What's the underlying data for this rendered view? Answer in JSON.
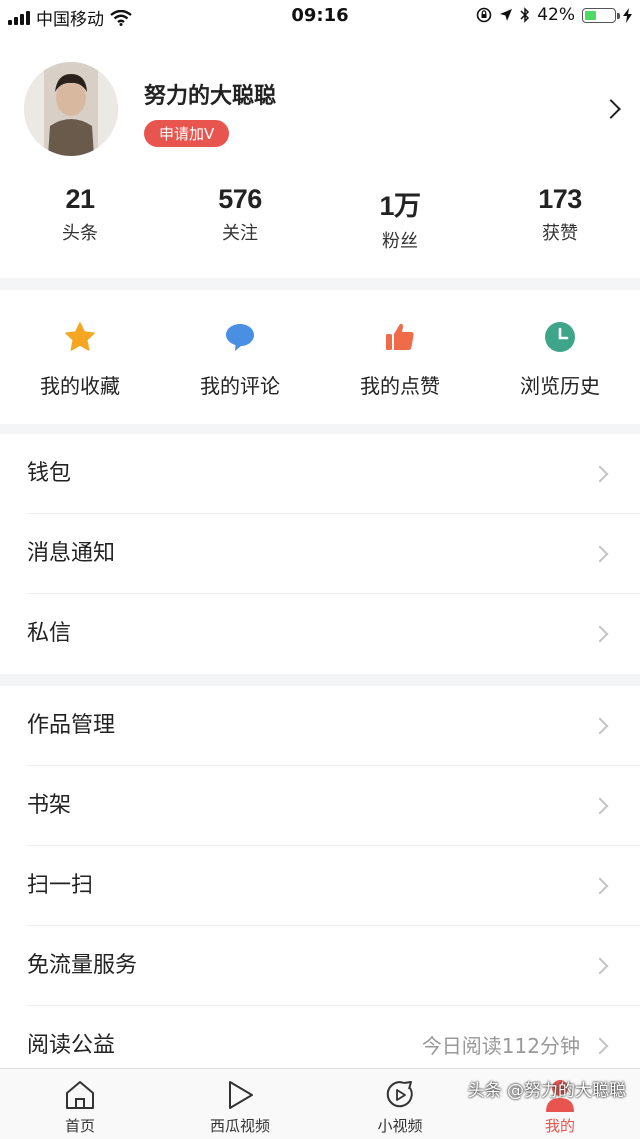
{
  "status_bar": {
    "carrier": "中国移动",
    "time": "09:16",
    "battery_percent": "42%",
    "battery_level": 0.42
  },
  "profile": {
    "username": "努力的大聪聪",
    "verify_badge": "申请加V",
    "stats": [
      {
        "value": "21",
        "label": "头条"
      },
      {
        "value": "576",
        "label": "关注"
      },
      {
        "value": "1万",
        "label": "粉丝"
      },
      {
        "value": "173",
        "label": "获赞"
      }
    ]
  },
  "quick_actions": [
    {
      "label": "我的收藏",
      "icon": "star-icon",
      "color": "#f5a623"
    },
    {
      "label": "我的评论",
      "icon": "comment-icon",
      "color": "#4a90e2"
    },
    {
      "label": "我的点赞",
      "icon": "thumbs-up-icon",
      "color": "#ef6b4a"
    },
    {
      "label": "浏览历史",
      "icon": "clock-icon",
      "color": "#3fa58a"
    }
  ],
  "menu_group_1": [
    {
      "label": "钱包"
    },
    {
      "label": "消息通知"
    },
    {
      "label": "私信"
    }
  ],
  "menu_group_2": [
    {
      "label": "作品管理"
    },
    {
      "label": "书架"
    },
    {
      "label": "扫一扫"
    },
    {
      "label": "免流量服务"
    },
    {
      "label": "阅读公益",
      "detail": "今日阅读112分钟"
    }
  ],
  "tab_bar": [
    {
      "label": "首页",
      "icon": "home-icon"
    },
    {
      "label": "西瓜视频",
      "icon": "play-icon"
    },
    {
      "label": "小视频",
      "icon": "short-video-icon"
    },
    {
      "label": "我的",
      "icon": "user-icon",
      "active": true
    }
  ],
  "watermark": "头条 @努力的大聪聪",
  "colors": {
    "accent": "#e8544e",
    "separator": "#f4f5f6"
  }
}
